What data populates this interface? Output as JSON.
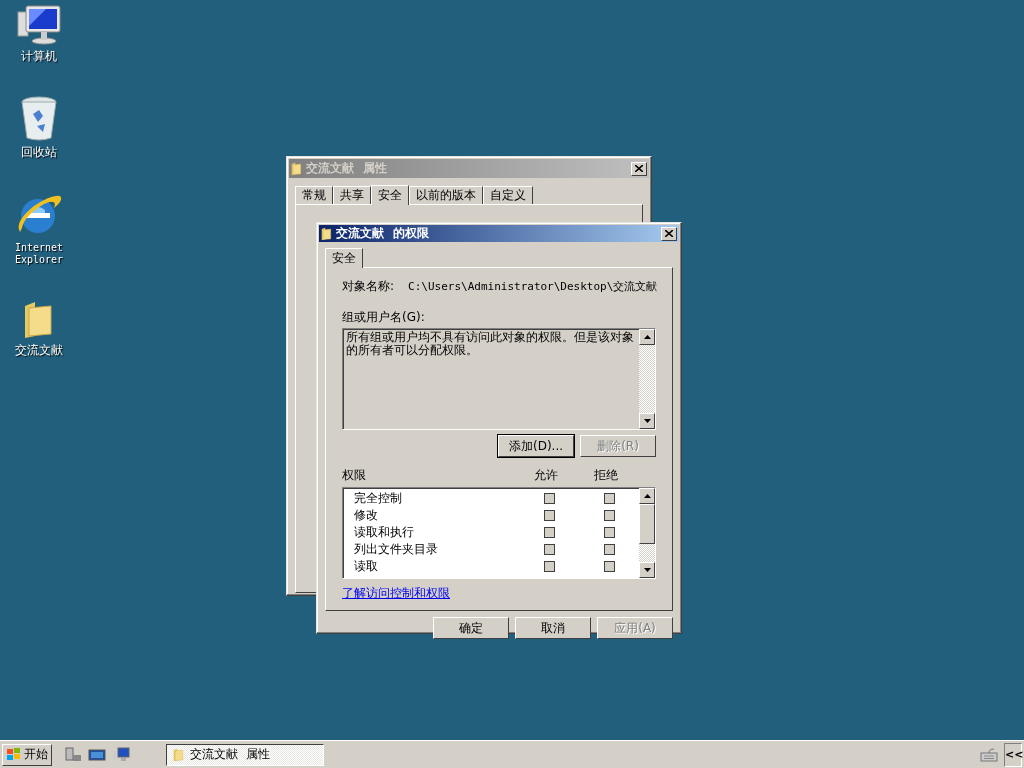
{
  "desktop_icons": [
    {
      "label": "计算机",
      "kind": "computer"
    },
    {
      "label": "回收站",
      "kind": "recycle"
    },
    {
      "label": "Internet Explorer",
      "kind": "browser"
    },
    {
      "label": "交流文献",
      "kind": "folder"
    }
  ],
  "back_window": {
    "title": "交流文献  属性",
    "active": false,
    "tabs": [
      {
        "label": "常规",
        "selected": false
      },
      {
        "label": "共享",
        "selected": false
      },
      {
        "label": "安全",
        "selected": true
      },
      {
        "label": "以前的版本",
        "selected": false
      },
      {
        "label": "自定义",
        "selected": false
      }
    ]
  },
  "dialog": {
    "title": "交流文献  的权限",
    "active": true,
    "tabs": [
      {
        "label": "安全",
        "selected": true
      }
    ],
    "object_label": "对象名称:",
    "object_path": "C:\\Users\\Administrator\\Desktop\\交流文献",
    "group_label": "组或用户名(G):",
    "group_message": "所有组或用户均不具有访问此对象的权限。但是该对象的所有者可以分配权限。",
    "group_buttons": [
      {
        "label": "添加(D)...",
        "disabled": false
      },
      {
        "label": "删除(R)",
        "disabled": true
      }
    ],
    "permissions": {
      "title": "权限",
      "allow_label": "允许",
      "deny_label": "拒绝",
      "rows": [
        {
          "name": "完全控制",
          "allow": false,
          "deny": false
        },
        {
          "name": "修改",
          "allow": false,
          "deny": false
        },
        {
          "name": "读取和执行",
          "allow": false,
          "deny": false
        },
        {
          "name": "列出文件夹目录",
          "allow": false,
          "deny": false
        },
        {
          "name": "读取",
          "allow": false,
          "deny": false
        }
      ]
    },
    "link": "了解访问控制和权限",
    "buttons": [
      {
        "label": "确定",
        "disabled": false
      },
      {
        "label": "取消",
        "disabled": false
      },
      {
        "label": "应用(A)",
        "disabled": true
      }
    ]
  },
  "taskbar": {
    "start_label": "开始",
    "tasks": [
      {
        "label": "交流文献  属性",
        "selected": true
      }
    ],
    "tray_toggle": "<<"
  }
}
